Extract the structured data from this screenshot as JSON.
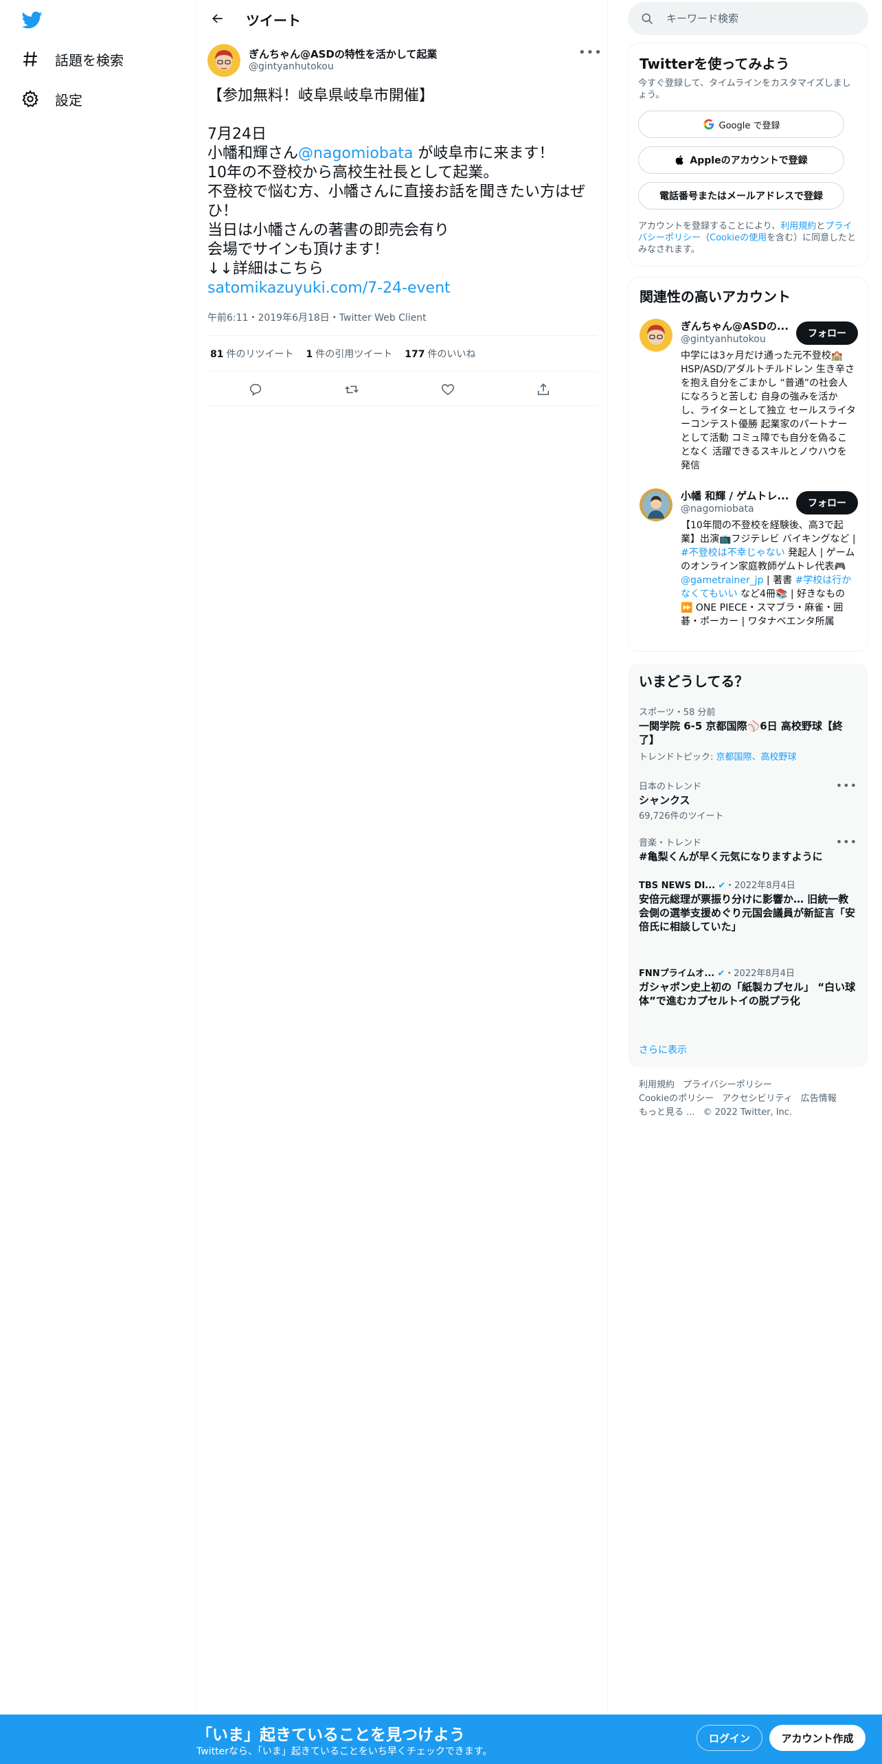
{
  "nav": {
    "items": [
      {
        "label": "話題を検索",
        "icon": "hashtag-icon"
      },
      {
        "label": "設定",
        "icon": "gear-icon"
      }
    ]
  },
  "header": {
    "title": "ツイート"
  },
  "tweet": {
    "author_name": "ぎんちゃん@ASDの特性を活かして起業",
    "author_handle": "@gintyanhutokou",
    "line1": "【参加無料！岐阜県岐阜市開催】",
    "line2": "7月24日",
    "line3_pre": "小幡和輝さん",
    "line3_mention": "@nagomiobata",
    "line3_post": " が岐阜市に来ます！",
    "line4": "10年の不登校から高校生社長として起業。",
    "line5": "不登校で悩む方、小幡さんに直接お話を聞きたい方はぜひ！",
    "line6": "当日は小幡さんの著書の即売会有り",
    "line7": "会場でサインも頂けます！",
    "line8": "↓↓詳細はこちら",
    "link": "satomikazuyuki.com/7-24-event",
    "meta": "午前6:11・2019年6月18日・Twitter Web Client",
    "retweets_count": "81",
    "retweets_label": "件のリツイート",
    "quotes_count": "1",
    "quotes_label": "件の引用ツイート",
    "likes_count": "177",
    "likes_label": "件のいいね"
  },
  "search": {
    "placeholder": "キーワード検索"
  },
  "signup_card": {
    "title": "Twitterを使ってみよう",
    "subtitle": "今すぐ登録して、タイムラインをカスタマイズしましょう。",
    "google": "Google で登録",
    "apple": "Appleのアカウントで登録",
    "phone": "電話番号またはメールアドレスで登録",
    "terms_1": "アカウントを登録することにより、",
    "terms_link1": "利用規約",
    "terms_2": "と",
    "terms_link2": "プライバシーポリシー",
    "terms_3": "（",
    "terms_link3": "Cookieの使用",
    "terms_4": "を含む）に同意したとみなされます。"
  },
  "related": {
    "title": "関連性の高いアカウント",
    "follow_label": "フォロー",
    "accounts": [
      {
        "name": "ぎんちゃん@ASDの...",
        "handle": "@gintyanhutokou",
        "bio": "中学には3ヶ月だけ通った元不登校🏫HSP/ASD/アダルトチルドレン 生き辛さを抱え自分をごまかし “普通”の社会人になろうと苦しむ 自身の強みを活かし、ライターとして独立 セールスライターコンテスト優勝 起業家のパートナーとして活動 コミュ障でも自分を偽ることなく 活躍できるスキルとノウハウを発信"
      },
      {
        "name": "小幡 和輝 / ゲムトレ...",
        "handle": "@nagomiobata",
        "bio_1": "【10年間の不登校を経験後、高3で起業】出演📺フジテレビ バイキングなど | ",
        "bio_tag1": "#不登校は不幸じゃない",
        "bio_2": " 発起人 | ゲームのオンライン家庭教師ゲムトレ代表🎮 ",
        "bio_mention": "@gametrainer_jp",
        "bio_3": " | 著書 ",
        "bio_tag2": "#学校は行かなくてもいい",
        "bio_4": " など4冊📚 | 好きなもの⏩ ONE PIECE・スマブラ・麻雀・囲碁・ポーカー | ワタナベエンタ所属"
      }
    ]
  },
  "trends": {
    "title": "いまどうしてる？",
    "items": [
      {
        "category": "スポーツ・58 分前",
        "title": "一関学院 6-5 京都国際⚾6日 高校野球【終了】",
        "sub_label": "トレンドトピック: ",
        "sub_links": "京都国際、高校野球"
      },
      {
        "category": "日本のトレンド",
        "title": "シャンクス",
        "sub": "69,726件のツイート"
      },
      {
        "category": "音楽・トレンド",
        "title": "#亀梨くんが早く元気になりますように"
      },
      {
        "category_source": "TBS NEWS DI...",
        "category_date": "・2022年8月4日",
        "title": "安倍元総理が票振り分けに影響か… 旧統一教会側の選挙支援めぐり元国会議員が新証言「安倍氏に相談していた」"
      },
      {
        "category_source": "FNNプライムオ...",
        "category_date": "・2022年8月4日",
        "title": "ガシャポン史上初の「紙製カプセル」 “白い球体”で進むカプセルトイの脱プラ化"
      }
    ],
    "show_more": "さらに表示"
  },
  "footer": {
    "links": [
      "利用規約",
      "プライバシーポリシー",
      "Cookieのポリシー",
      "アクセシビリティ",
      "広告情報",
      "もっと見る ..."
    ],
    "copyright": "© 2022 Twitter, Inc."
  },
  "bottom_bar": {
    "title": "「いま」起きていることを見つけよう",
    "subtitle": "Twitterなら、「いま」起きていることをいち早くチェックできます。",
    "login": "ログイン",
    "signup": "アカウント作成"
  },
  "colors": {
    "accent": "#1d9bf0",
    "text": "#0f1419",
    "muted": "#536471",
    "border": "#eff3f4"
  }
}
